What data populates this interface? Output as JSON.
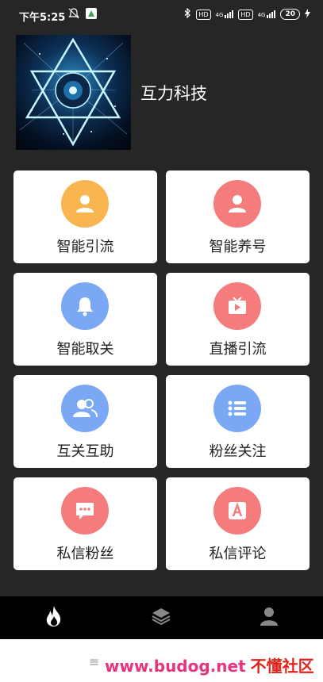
{
  "status_bar": {
    "time": "下午5:25",
    "hd1": "HD",
    "hd2": "HD",
    "net1": "4G",
    "net2": "4G",
    "battery": "20"
  },
  "header": {
    "company_name": "互力科技"
  },
  "grid": [
    {
      "label": "智能引流",
      "icon": "user-icon",
      "color": "#f9b54f"
    },
    {
      "label": "智能养号",
      "icon": "user-icon",
      "color": "#f57c7c"
    },
    {
      "label": "智能取关",
      "icon": "bell-icon",
      "color": "#7aa8f4"
    },
    {
      "label": "直播引流",
      "icon": "tv-icon",
      "color": "#f57c7c"
    },
    {
      "label": "互关互助",
      "icon": "users-icon",
      "color": "#7aa8f4"
    },
    {
      "label": "粉丝关注",
      "icon": "list-icon",
      "color": "#7aa8f4"
    },
    {
      "label": "私信粉丝",
      "icon": "message-icon",
      "color": "#f57c7c"
    },
    {
      "label": "私信评论",
      "icon": "letter-a-icon",
      "color": "#f57c7c"
    }
  ],
  "bottom_nav": [
    "fire-icon",
    "layers-icon",
    "person-icon"
  ],
  "watermark": {
    "url": "www.budog.net",
    "cn": "不懂社区"
  }
}
